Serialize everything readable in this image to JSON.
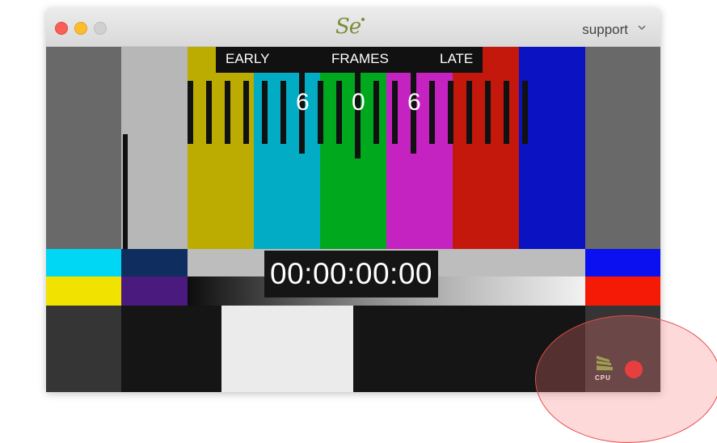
{
  "window": {
    "logo_text": "Se",
    "account_label": "support",
    "icons": [
      "close-icon",
      "minimize-icon",
      "zoom-icon",
      "chevron-down-icon"
    ],
    "traffic_light_colors": {
      "close": "#fc5f57",
      "minimize": "#fdbc2e",
      "zoom_disabled": "#d0d0d0"
    }
  },
  "preview": {
    "early_label": "EARLY",
    "frames_label": "FRAMES",
    "late_label": "LATE",
    "offset_left": "6",
    "offset_center": "0",
    "offset_right": "6",
    "timecode": "00:00:00:00",
    "bar_colors": [
      "#b7b7b7",
      "#bcab00",
      "#01acc4",
      "#00a81e",
      "#c523c1",
      "#c4180d",
      "#0b12c2"
    ]
  },
  "status": {
    "cpu_label": "CPU",
    "cpu_icon": "cpu-meter-icon",
    "record_icon": "record-indicator-icon",
    "record_color": "#e2292a",
    "highlight_color": "#e84a4a"
  }
}
